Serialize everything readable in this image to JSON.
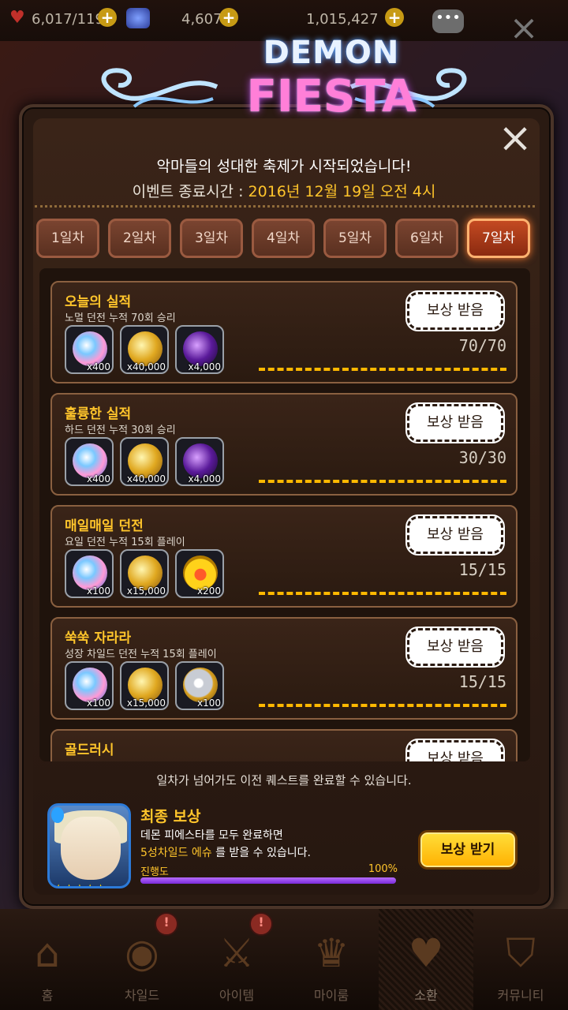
{
  "topbar": {
    "stamina": "6,017/119",
    "gems": "4,607",
    "gold": "1,015,427"
  },
  "dialog": {
    "logo_line1": "DEMON",
    "logo_line2": "FIESTA",
    "subtitle": "악마들의 성대한 축제가 시작되었습니다!",
    "time_label": "이벤트 종료시간 : ",
    "time_value": "2016년 12월 19일 오전 4시",
    "tabs": [
      {
        "label": "1일차"
      },
      {
        "label": "2일차"
      },
      {
        "label": "3일차"
      },
      {
        "label": "4일차"
      },
      {
        "label": "5일차"
      },
      {
        "label": "6일차"
      },
      {
        "label": "7일차",
        "active": true
      }
    ],
    "quests": [
      {
        "title": "오늘의 실적",
        "desc": "노멀 던전 누적 70회 승리",
        "rewards": [
          {
            "icon": "gem-icon",
            "count": "x400"
          },
          {
            "icon": "gold-coins-icon",
            "count": "x40,000"
          },
          {
            "icon": "dark-gem-icon",
            "count": "x4,000"
          }
        ],
        "claim": "보상 받음",
        "progress": "70/70"
      },
      {
        "title": "훌륭한 실적",
        "desc": "하드 던전 누적 30회 승리",
        "rewards": [
          {
            "icon": "gem-icon",
            "count": "x400"
          },
          {
            "icon": "gold-coins-icon",
            "count": "x40,000"
          },
          {
            "icon": "dark-gem-icon",
            "count": "x4,000"
          }
        ],
        "claim": "보상 받음",
        "progress": "30/30"
      },
      {
        "title": "매일매일 던전",
        "desc": "요일 던전 누적 15회 플레이",
        "rewards": [
          {
            "icon": "gem-icon",
            "count": "x100"
          },
          {
            "icon": "gold-coins-icon",
            "count": "x15,000"
          },
          {
            "icon": "medal-icon",
            "count": "x200"
          }
        ],
        "claim": "보상 받음",
        "progress": "15/15"
      },
      {
        "title": "쑥쑥 자라라",
        "desc": "성장 차일드 던전 누적 15회 플레이",
        "rewards": [
          {
            "icon": "gem-icon",
            "count": "x100"
          },
          {
            "icon": "gold-coins-icon",
            "count": "x15,000"
          },
          {
            "icon": "silver-coin-icon",
            "count": "x100"
          }
        ],
        "claim": "보상 받음",
        "progress": "15/15"
      },
      {
        "title": "골드러시",
        "desc": "",
        "rewards": [],
        "claim": "보상 받음",
        "progress": ""
      }
    ],
    "notice": "일차가 넘어가도 이전 퀘스트를 완료할 수 있습니다.",
    "final": {
      "title": "최종 보상",
      "desc1": "데몬 피에스타를 모두 완료하면",
      "desc2_highlight": "5성차일드 에슈",
      "desc2_rest": " 를 받을 수 있습니다.",
      "progress_label": "진행도",
      "progress_value": "100%",
      "progress_fraction": 1.0,
      "stars": "★★★★★",
      "claim_button": "보상 받기"
    }
  },
  "nav": [
    {
      "label": "홈",
      "icon": "home-icon"
    },
    {
      "label": "차일드",
      "icon": "child-icon",
      "badge": "!"
    },
    {
      "label": "아이템",
      "icon": "item-icon",
      "badge": "!"
    },
    {
      "label": "마이룸",
      "icon": "myroom-icon"
    },
    {
      "label": "소환",
      "icon": "summon-icon",
      "active": true
    },
    {
      "label": "커뮤니티",
      "icon": "community-icon"
    }
  ],
  "colors": {
    "accent_gold": "#ffc52b",
    "active_tab": "#c44a22",
    "progress_bar": "#ffb800"
  }
}
